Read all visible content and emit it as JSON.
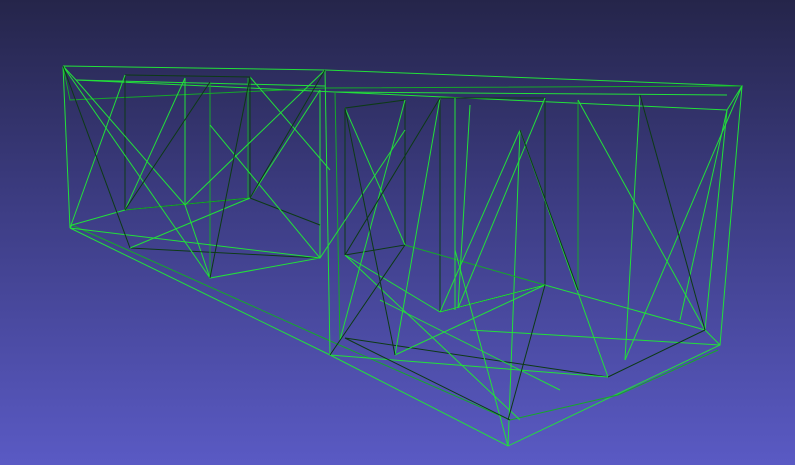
{
  "scene": {
    "background_top": "#25254a",
    "background_bottom": "#5a5ac4",
    "edge_color_bright": "#22e03a",
    "edge_color_dark": "#0c3a14",
    "object": "wireframe-box-mesh"
  }
}
